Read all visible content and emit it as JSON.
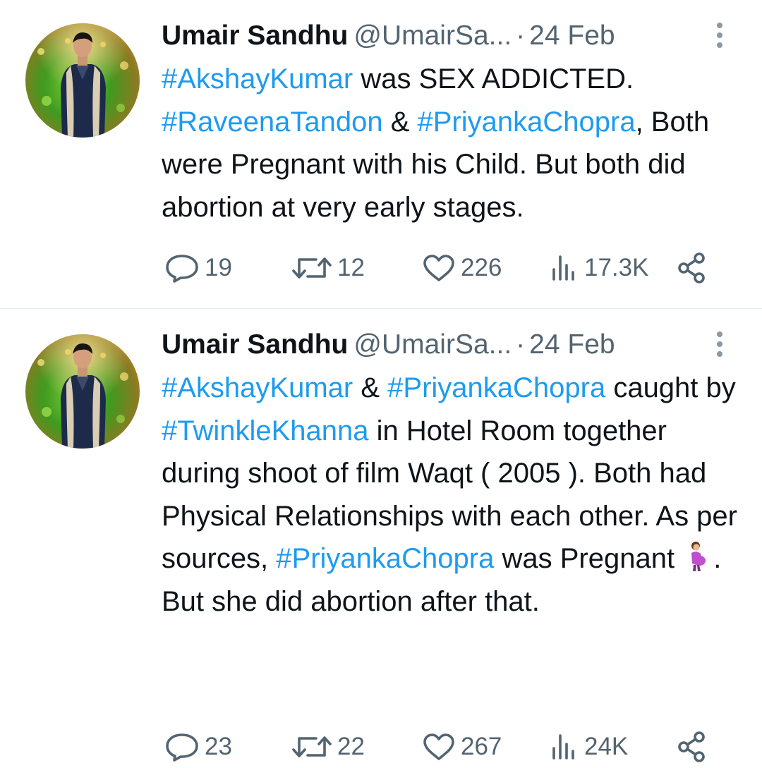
{
  "tweets": [
    {
      "author": {
        "display_name": "Umair Sandhu",
        "handle": "@UmairSa...",
        "separator": "·",
        "date": "24 Feb",
        "avatar_icon": "profile-photo"
      },
      "body": [
        {
          "t": "tag",
          "v": "#AkshayKumar"
        },
        {
          "t": "text",
          "v": " was SEX ADDICTED. "
        },
        {
          "t": "tag",
          "v": "#RaveenaTandon"
        },
        {
          "t": "text",
          "v": " & "
        },
        {
          "t": "tag",
          "v": "#PriyankaChopra"
        },
        {
          "t": "text",
          "v": ", Both were Pregnant with his Child. But both did abortion at very early stages."
        }
      ],
      "stats": {
        "replies": "19",
        "retweets": "12",
        "likes": "226",
        "views": "17.3K"
      }
    },
    {
      "author": {
        "display_name": "Umair Sandhu",
        "handle": "@UmairSa...",
        "separator": "·",
        "date": "24 Feb",
        "avatar_icon": "profile-photo"
      },
      "body": [
        {
          "t": "tag",
          "v": "#AkshayKumar"
        },
        {
          "t": "text",
          "v": " & "
        },
        {
          "t": "tag",
          "v": "#PriyankaChopra"
        },
        {
          "t": "text",
          "v": " caught by "
        },
        {
          "t": "tag",
          "v": "#TwinkleKhanna"
        },
        {
          "t": "text",
          "v": " in Hotel Room together during shoot of film Waqt ( 2005 ). Both had Physical Relationships with each other. As per sources, "
        },
        {
          "t": "tag",
          "v": "#PriyankaChopra"
        },
        {
          "t": "text",
          "v": " was Pregnant "
        },
        {
          "t": "emoji",
          "v": "pregnant-woman-emoji"
        },
        {
          "t": "text",
          "v": ". But she did abortion after that."
        }
      ],
      "stats": {
        "replies": "23",
        "retweets": "22",
        "likes": "267",
        "views": "24K"
      }
    }
  ],
  "colors": {
    "hashtag": "#1d9bf0",
    "secondary_text": "#536471",
    "primary_text": "#0f1419",
    "divider": "#e6ecf0"
  },
  "icons": {
    "reply": "reply-icon",
    "retweet": "retweet-icon",
    "like": "heart-icon",
    "views": "views-chart-icon",
    "share": "share-icon",
    "more": "more-vertical-icon"
  }
}
